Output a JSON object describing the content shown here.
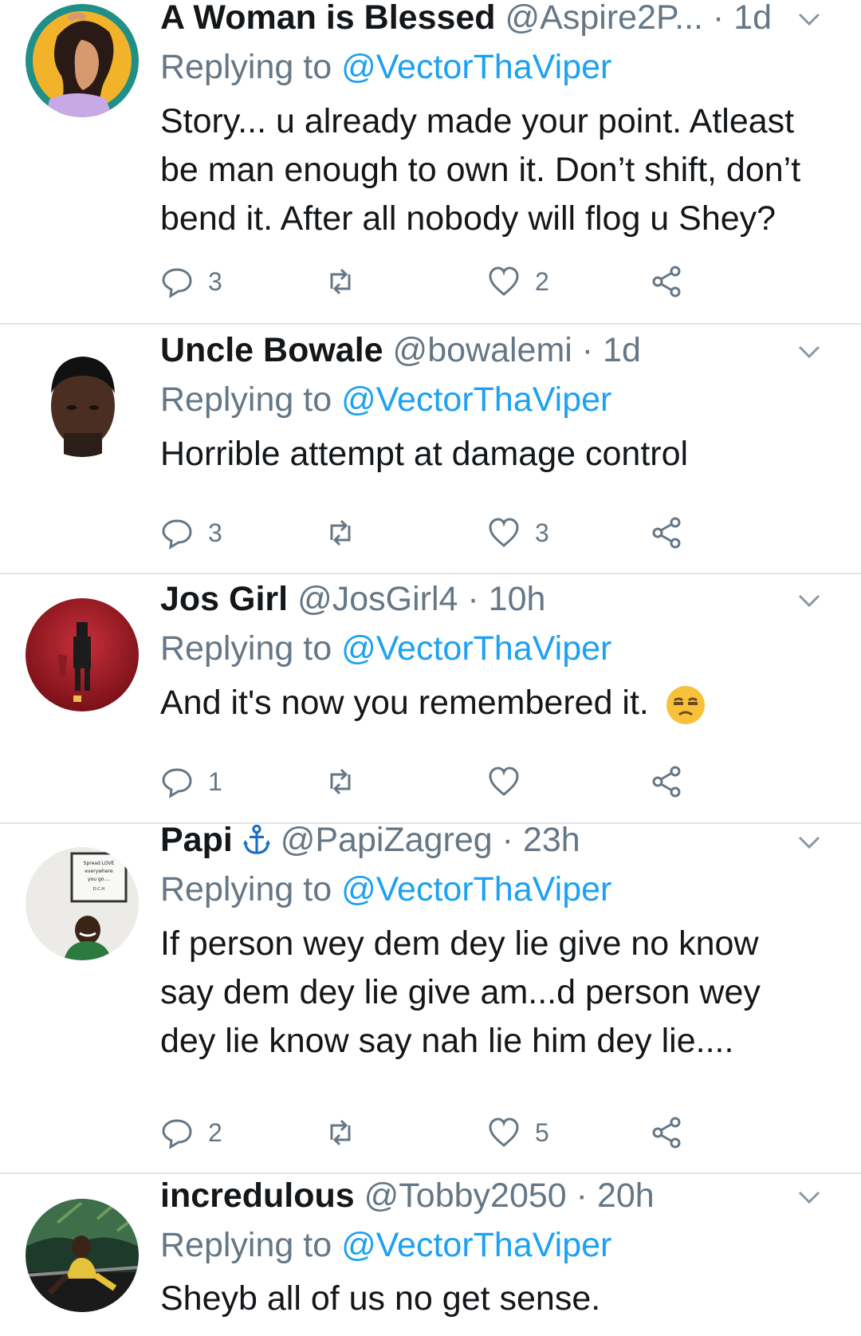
{
  "replying_label": "Replying to",
  "tweets": [
    {
      "name": "A Woman is Blessed",
      "handle": "@Aspire2P...",
      "time": "· 1d",
      "mention": "@VectorThaViper",
      "text_lines": [
        "Story... u already made your point. Atleast",
        "be man enough to own it. Don’t shift, don’t",
        "bend it. After all nobody will flog u Shey?"
      ],
      "replies": "3",
      "likes": "2"
    },
    {
      "name": "Uncle Bowale",
      "handle": "@bowalemi",
      "time": "· 1d",
      "mention": "@VectorThaViper",
      "text_lines": [
        "Horrible attempt at damage control"
      ],
      "replies": "3",
      "likes": "3"
    },
    {
      "name": "Jos Girl",
      "handle": "@JosGirl4",
      "time": "· 10h",
      "mention": "@VectorThaViper",
      "text_lines": [
        "And it's now you remembered it."
      ],
      "replies": "1",
      "likes": ""
    },
    {
      "name": "Papi",
      "handle": "@PapiZagreg",
      "time": "· 23h",
      "mention": "@VectorThaViper",
      "text_lines": [
        "If person wey dem dey lie give no know",
        "say dem dey lie give am...d person wey",
        "dey lie know say nah lie him dey lie...."
      ],
      "replies": "2",
      "likes": "5"
    },
    {
      "name": "incredulous",
      "handle": "@Tobby2050",
      "time": "· 20h",
      "mention": "@VectorThaViper",
      "text_lines": [
        "Sheyb all of us no get sense."
      ],
      "replies": "",
      "likes": ""
    }
  ],
  "avatar_signs": {
    "papi_sign_lines": [
      "Spread LOVE",
      "everywhere",
      "you go....",
      "D.C.H"
    ]
  }
}
